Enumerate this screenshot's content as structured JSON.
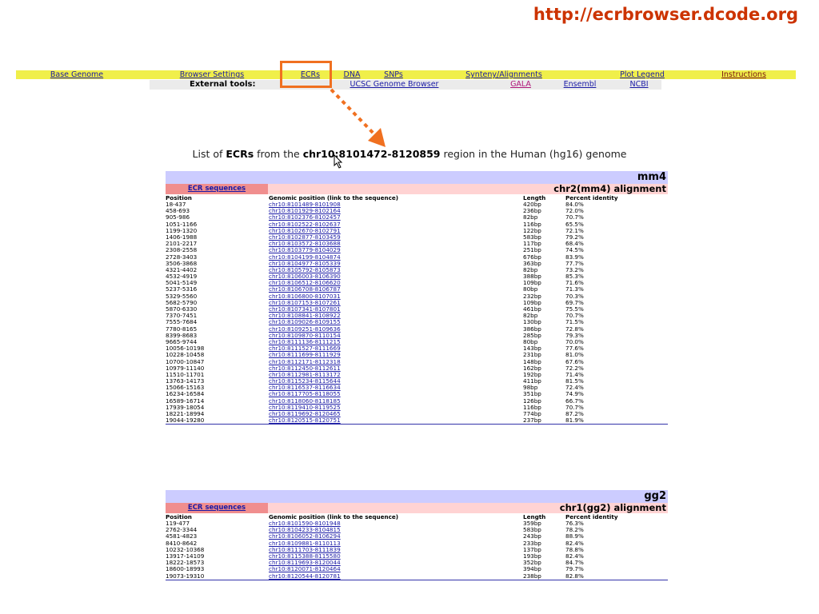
{
  "site_url": "http://ecrbrowser.dcode.org",
  "nav": {
    "base_genome": "Base Genome",
    "browser_settings": "Browser Settings",
    "ecrs": "ECRs",
    "dna": "DNA",
    "snps": "SNPs",
    "synteny": "Synteny/Alignments",
    "plot_legend": "Plot Legend",
    "instructions": "Instructions"
  },
  "external_tools": {
    "label": "External tools:",
    "ucsc": "UCSC Genome Browser",
    "gala": "GALA",
    "ensembl": "Ensembl",
    "ncbi": "NCBI"
  },
  "title": {
    "prefix": "List of ",
    "ecrs": "ECRs",
    "middle": " from the ",
    "region": "chr10:8101472-8120859",
    "suffix": " region in the Human (hg16) genome"
  },
  "columns": {
    "position": "Position",
    "genomic": "Genomic position (link to the sequence)",
    "length": "Length",
    "identity": "Percent identity"
  },
  "tables": [
    {
      "species": "mm4",
      "alignment": "chr2(mm4) alignment",
      "ecr_sequences": "ECR sequences",
      "rows": [
        [
          "18-437",
          "chr10:8101489-8101908",
          "420bp",
          "84.0%"
        ],
        [
          "458-693",
          "chr10:8101929-8102164",
          "236bp",
          "72.0%"
        ],
        [
          "905-986",
          "chr10:8102376-8102457",
          "82bp",
          "70.7%"
        ],
        [
          "1051-1166",
          "chr10:8102522-8102637",
          "116bp",
          "65.5%"
        ],
        [
          "1199-1320",
          "chr10:8102670-8102791",
          "122bp",
          "72.1%"
        ],
        [
          "1406-1988",
          "chr10:8102877-8103459",
          "583bp",
          "79.2%"
        ],
        [
          "2101-2217",
          "chr10:8103572-8103688",
          "117bp",
          "68.4%"
        ],
        [
          "2308-2558",
          "chr10:8103779-8104029",
          "251bp",
          "74.5%"
        ],
        [
          "2728-3403",
          "chr10:8104199-8104874",
          "676bp",
          "83.9%"
        ],
        [
          "3506-3868",
          "chr10:8104977-8105339",
          "363bp",
          "77.7%"
        ],
        [
          "4321-4402",
          "chr10:8105792-8105873",
          "82bp",
          "73.2%"
        ],
        [
          "4532-4919",
          "chr10:8106003-8106390",
          "388bp",
          "85.3%"
        ],
        [
          "5041-5149",
          "chr10:8106512-8106620",
          "109bp",
          "71.6%"
        ],
        [
          "5237-5316",
          "chr10:8106708-8106787",
          "80bp",
          "71.3%"
        ],
        [
          "5329-5560",
          "chr10:8106800-8107031",
          "232bp",
          "70.3%"
        ],
        [
          "5682-5790",
          "chr10:8107153-8107261",
          "109bp",
          "69.7%"
        ],
        [
          "5870-6330",
          "chr10:8107341-8107801",
          "461bp",
          "75.5%"
        ],
        [
          "7370-7451",
          "chr10:8108841-8108922",
          "82bp",
          "70.7%"
        ],
        [
          "7555-7684",
          "chr10:8109026-8109155",
          "130bp",
          "71.5%"
        ],
        [
          "7780-8165",
          "chr10:8109251-8109636",
          "386bp",
          "72.8%"
        ],
        [
          "8399-8683",
          "chr10:8109870-8110154",
          "285bp",
          "79.3%"
        ],
        [
          "9665-9744",
          "chr10:8111136-8111215",
          "80bp",
          "70.0%"
        ],
        [
          "10056-10198",
          "chr10:8111527-8111669",
          "143bp",
          "77.6%"
        ],
        [
          "10228-10458",
          "chr10:8111699-8111929",
          "231bp",
          "81.0%"
        ],
        [
          "10700-10847",
          "chr10:8112171-8112318",
          "148bp",
          "67.6%"
        ],
        [
          "10979-11140",
          "chr10:8112450-8112611",
          "162bp",
          "72.2%"
        ],
        [
          "11510-11701",
          "chr10:8112981-8113172",
          "192bp",
          "71.4%"
        ],
        [
          "13763-14173",
          "chr10:8115234-8115644",
          "411bp",
          "81.5%"
        ],
        [
          "15066-15163",
          "chr10:8116537-8116634",
          "98bp",
          "72.4%"
        ],
        [
          "16234-16584",
          "chr10:8117705-8118055",
          "351bp",
          "74.9%"
        ],
        [
          "16589-16714",
          "chr10:8118060-8118185",
          "126bp",
          "66.7%"
        ],
        [
          "17939-18054",
          "chr10:8119410-8119525",
          "116bp",
          "70.7%"
        ],
        [
          "18221-18994",
          "chr10:8119692-8120465",
          "774bp",
          "87.2%"
        ],
        [
          "19044-19280",
          "chr10:8120515-8120751",
          "237bp",
          "81.9%"
        ]
      ]
    },
    {
      "species": "gg2",
      "alignment": "chr1(gg2) alignment",
      "ecr_sequences": "ECR sequences",
      "rows": [
        [
          "119-477",
          "chr10:8101590-8101948",
          "359bp",
          "76.3%"
        ],
        [
          "2762-3344",
          "chr10:8104233-8104815",
          "583bp",
          "78.2%"
        ],
        [
          "4581-4823",
          "chr10:8106052-8106294",
          "243bp",
          "88.9%"
        ],
        [
          "8410-8642",
          "chr10:8109881-8110113",
          "233bp",
          "82.4%"
        ],
        [
          "10232-10368",
          "chr10:8111703-8111839",
          "137bp",
          "78.8%"
        ],
        [
          "13917-14109",
          "chr10:8115388-8115580",
          "193bp",
          "82.4%"
        ],
        [
          "18222-18573",
          "chr10:8119693-8120044",
          "352bp",
          "84.7%"
        ],
        [
          "18600-18993",
          "chr10:8120071-8120464",
          "394bp",
          "79.7%"
        ],
        [
          "19073-19310",
          "chr10:8120544-8120781",
          "238bp",
          "82.8%"
        ]
      ]
    }
  ]
}
